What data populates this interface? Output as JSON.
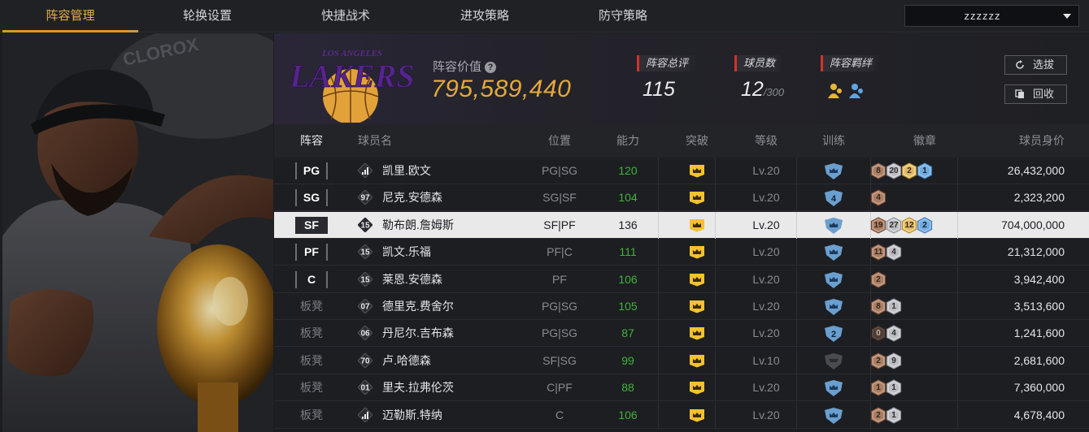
{
  "nav": {
    "tabs": [
      "阵容管理",
      "轮换设置",
      "快捷战术",
      "进攻策略",
      "防守策略"
    ],
    "active_tab": "阵容管理",
    "team_select_value": "zzzzzz"
  },
  "header": {
    "team_logo": "lakers-logo",
    "logo_text_top": "LOS ANGELES",
    "logo_text_main": "LAKERS",
    "value_label": "阵容价值",
    "value_help_icon": "question-icon",
    "value": "795,589,440",
    "rating_label": "阵容总评",
    "rating_value": "115",
    "players_label": "球员数",
    "players_value": "12",
    "players_max": "/300",
    "bond_label": "阵容羁绊",
    "select_button": "选拔",
    "recycle_button": "回收"
  },
  "table": {
    "columns": [
      "阵容",
      "球员名",
      "位置",
      "能力",
      "突破",
      "等级",
      "训练",
      "徽章",
      "球员身价"
    ],
    "rows": [
      {
        "slot": "PG",
        "slot_type": "starter",
        "number": "bars",
        "name": "凯里.欧文",
        "position": "PG|SG",
        "ability": "120",
        "level": "Lv.20",
        "training": "crown",
        "badges": [
          {
            "n": "8",
            "t": "bronze"
          },
          {
            "n": "20",
            "t": "silver"
          },
          {
            "n": "2",
            "t": "gold"
          },
          {
            "n": "1",
            "t": "blue"
          }
        ],
        "value": "26,432,000"
      },
      {
        "slot": "SG",
        "slot_type": "starter",
        "number": "97",
        "name": "尼克.安德森",
        "position": "SG|SF",
        "ability": "104",
        "level": "Lv.20",
        "training": "4",
        "badges": [
          {
            "n": "4",
            "t": "bronze"
          }
        ],
        "value": "2,323,200"
      },
      {
        "slot": "SF",
        "slot_type": "starter",
        "number": "15",
        "name": "勒布朗.詹姆斯",
        "position": "SF|PF",
        "ability": "136",
        "level": "Lv.20",
        "training": "crown",
        "badges": [
          {
            "n": "19",
            "t": "bronze"
          },
          {
            "n": "27",
            "t": "silver"
          },
          {
            "n": "12",
            "t": "gold"
          },
          {
            "n": "2",
            "t": "blue"
          }
        ],
        "value": "704,000,000",
        "selected": true
      },
      {
        "slot": "PF",
        "slot_type": "starter",
        "number": "15",
        "name": "凯文.乐福",
        "position": "PF|C",
        "ability": "111",
        "level": "Lv.20",
        "training": "crown",
        "badges": [
          {
            "n": "11",
            "t": "bronze"
          },
          {
            "n": "4",
            "t": "silver"
          }
        ],
        "value": "21,312,000"
      },
      {
        "slot": "C",
        "slot_type": "starter",
        "number": "15",
        "name": "莱恩.安德森",
        "position": "PF",
        "ability": "106",
        "level": "Lv.20",
        "training": "crown",
        "badges": [
          {
            "n": "2",
            "t": "bronze"
          }
        ],
        "value": "3,942,400"
      },
      {
        "slot": "板凳",
        "slot_type": "bench",
        "number": "07",
        "name": "德里克.费舍尔",
        "position": "PG|SG",
        "ability": "105",
        "level": "Lv.20",
        "training": "crown",
        "badges": [
          {
            "n": "8",
            "t": "bronze"
          },
          {
            "n": "1",
            "t": "silver"
          }
        ],
        "value": "3,513,600"
      },
      {
        "slot": "板凳",
        "slot_type": "bench",
        "number": "06",
        "name": "丹尼尔.吉布森",
        "position": "PG|SG",
        "ability": "87",
        "level": "Lv.20",
        "training": "2",
        "badges": [
          {
            "n": "0",
            "t": "dark"
          },
          {
            "n": "4",
            "t": "silver"
          }
        ],
        "value": "1,241,600"
      },
      {
        "slot": "板凳",
        "slot_type": "bench",
        "number": "70",
        "name": "卢.哈德森",
        "position": "SF|SG",
        "ability": "99",
        "level": "Lv.10",
        "training": "grey",
        "badges": [
          {
            "n": "2",
            "t": "bronze"
          },
          {
            "n": "9",
            "t": "silver"
          }
        ],
        "value": "2,681,600"
      },
      {
        "slot": "板凳",
        "slot_type": "bench",
        "number": "01",
        "name": "里夫.拉弗伦茨",
        "position": "C|PF",
        "ability": "88",
        "level": "Lv.20",
        "training": "crown",
        "badges": [
          {
            "n": "1",
            "t": "bronze"
          },
          {
            "n": "1",
            "t": "silver"
          }
        ],
        "value": "7,360,000"
      },
      {
        "slot": "板凳",
        "slot_type": "bench",
        "number": "bars",
        "name": "迈勒斯.特纳",
        "position": "C",
        "ability": "106",
        "level": "Lv.20",
        "training": "crown",
        "badges": [
          {
            "n": "2",
            "t": "bronze"
          },
          {
            "n": "1",
            "t": "silver"
          }
        ],
        "value": "4,678,400"
      }
    ]
  },
  "colors": {
    "accent": "#e4a93a",
    "ability_green": "#3fb33b",
    "label_red": "#d2322b",
    "break_yellow": "#f2c230",
    "train_blue": "#6a9fcf"
  }
}
